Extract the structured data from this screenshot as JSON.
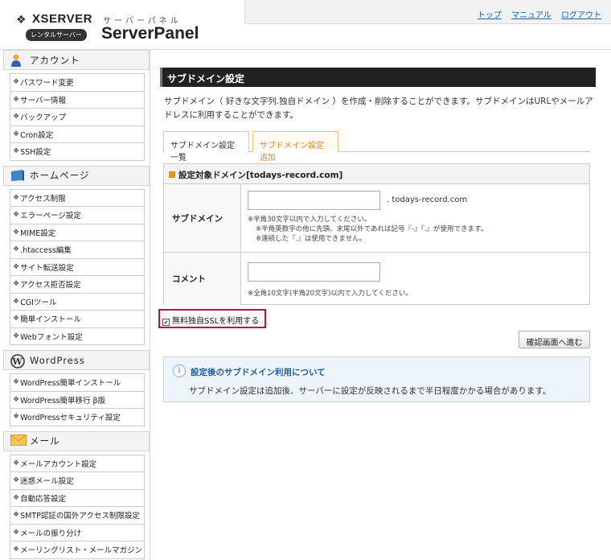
{
  "header": {
    "logo_text": "XSERVER",
    "rental_badge": "レンタルサーバー",
    "panel_sub": "サーバーパネル",
    "panel_title": "ServerPanel",
    "nav": [
      "トップ",
      "マニュアル",
      "ログアウト"
    ]
  },
  "sidebar": {
    "sections": [
      {
        "title": "アカウント",
        "icon": "person-icon",
        "items": [
          "パスワード変更",
          "サーバー情報",
          "バックアップ",
          "Cron設定",
          "SSH設定"
        ]
      },
      {
        "title": "ホームページ",
        "icon": "homepage-icon",
        "items": [
          "アクセス制限",
          "エラーページ設定",
          "MIME設定",
          ".htaccess編集",
          "サイト転送設定",
          "アクセス拒否設定",
          "CGIツール",
          "簡単インストール",
          "Webフォント設定"
        ]
      },
      {
        "title": "WordPress",
        "icon": "wordpress-icon",
        "items": [
          "WordPress簡単インストール",
          "WordPress簡単移行 β版",
          "WordPressセキュリティ設定"
        ]
      },
      {
        "title": "メール",
        "icon": "mail-icon",
        "items": [
          "メールアカウント設定",
          "迷惑メール設定",
          "自動応答設定",
          "SMTP認証の国外アクセス制限設定",
          "メールの振り分け",
          "メーリングリスト・メールマガジン"
        ]
      }
    ]
  },
  "main": {
    "title": "サブドメイン設定",
    "description": "サブドメイン（ 好きな文字列.独自ドメイン ）を作成・削除することができます。サブドメインはURLやメールアドレスに利用することができます。",
    "tabs": [
      "サブドメイン設定一覧",
      "サブドメイン設定追加"
    ],
    "form_heading": "設定対象ドメイン[todays-record.com]",
    "subdomain_label": "サブドメイン",
    "subdomain_value": "",
    "domain_suffix": ". todays-record.com",
    "subdomain_notes": [
      "※半角30文字以内で入力してください。",
      "※半角英数字の他に先頭、末尾以外であれば記号『-』『.』が使用できます。",
      "※連続した『.』は使用できません。"
    ],
    "comment_label": "コメント",
    "comment_value": "",
    "comment_note": "※全角10文字(半角20文字)以内で入力してください。",
    "ssl_label": "無料独自SSLを利用する",
    "ssl_checked": true,
    "confirm_button": "確認画面へ進む",
    "info_title": "設定後のサブドメイン利用について",
    "info_text": "サブドメイン設定は追加後、サーバーに設定が反映されるまで半日程度かかる場合があります。"
  },
  "colors": {
    "active_tab": "#e08a1e",
    "highlight": "#b0124b",
    "link": "#1a5fae",
    "info_bg": "#eef4fb"
  }
}
